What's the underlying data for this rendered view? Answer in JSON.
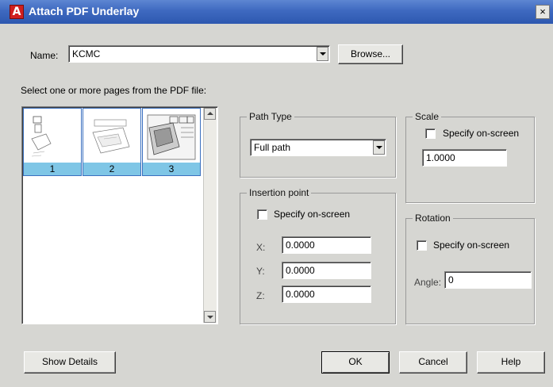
{
  "window": {
    "title": "Attach PDF Underlay",
    "close_glyph": "×"
  },
  "name_row": {
    "label": "Name:",
    "value": "KCMC",
    "browse_label": "Browse..."
  },
  "pages": {
    "instruction": "Select one or more pages from the PDF file:",
    "items": [
      {
        "label": "1",
        "icon": "pdf-page-thumbnail"
      },
      {
        "label": "2",
        "icon": "pdf-page-thumbnail"
      },
      {
        "label": "3",
        "icon": "pdf-page-thumbnail"
      }
    ]
  },
  "path_type": {
    "title": "Path Type",
    "selected": "Full path"
  },
  "insertion": {
    "title": "Insertion point",
    "specify_label": "Specify on-screen",
    "x_label": "X:",
    "x_value": "0.0000",
    "y_label": "Y:",
    "y_value": "0.0000",
    "z_label": "Z:",
    "z_value": "0.0000"
  },
  "scale": {
    "title": "Scale",
    "specify_label": "Specify on-screen",
    "value": "1.0000"
  },
  "rotation": {
    "title": "Rotation",
    "specify_label": "Specify on-screen",
    "angle_label": "Angle:",
    "angle_value": "0"
  },
  "buttons": {
    "show_details": "Show Details",
    "ok": "OK",
    "cancel": "Cancel",
    "help": "Help"
  },
  "colors": {
    "title_bar": "#3e69c0",
    "selection": "#7fc6e6",
    "dialog_bg": "#d6d6d2"
  }
}
